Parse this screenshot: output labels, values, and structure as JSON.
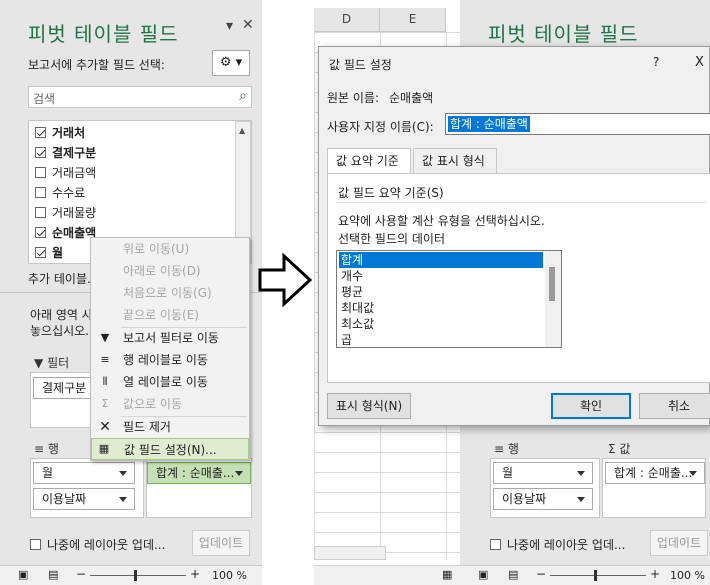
{
  "left_pane": {
    "title": "피벗 테이블 필드",
    "subtitle": "보고서에 추가할 필드 선택:",
    "search_placeholder": "검색",
    "fields": [
      {
        "label": "거래처",
        "checked": true
      },
      {
        "label": "결제구분",
        "checked": true
      },
      {
        "label": "거래금액",
        "checked": false
      },
      {
        "label": "수수료",
        "checked": false
      },
      {
        "label": "거래물량",
        "checked": false
      },
      {
        "label": "순매출액",
        "checked": true
      },
      {
        "label": "월",
        "checked": true
      }
    ],
    "more_tables_label": "추가 테이블...",
    "areas_hint_line1": "아래 영역 사",
    "areas_hint_line2": "놓으십시오.",
    "filter_header": "필터",
    "filter_item": "결제구분",
    "rows_header": "행",
    "rows_items": [
      "월",
      "이용날짜"
    ],
    "values_item": "합계 : 순매출...",
    "defer_label": "나중에 레이아웃 업데...",
    "update_button": "업데이트",
    "zoom": "100 %"
  },
  "context_menu": [
    {
      "label": "위로 이동(U)",
      "disabled": true,
      "icon": ""
    },
    {
      "label": "아래로 이동(D)",
      "disabled": true,
      "icon": ""
    },
    {
      "label": "처음으로 이동(G)",
      "disabled": true,
      "icon": ""
    },
    {
      "label": "끝으로 이동(E)",
      "disabled": true,
      "icon": ""
    },
    {
      "label": "보고서 필터로 이동",
      "disabled": false,
      "icon": "filter-icon"
    },
    {
      "label": "행 레이블로 이동",
      "disabled": false,
      "icon": "rows-icon"
    },
    {
      "label": "열 레이블로 이동",
      "disabled": false,
      "icon": "columns-icon"
    },
    {
      "label": "값으로 이동",
      "disabled": true,
      "icon": "sigma-icon"
    },
    {
      "label": "필드 제거",
      "disabled": false,
      "icon": "close-icon"
    },
    {
      "label": "값 필드 설정(N)...",
      "disabled": false,
      "icon": "field-settings-icon"
    }
  ],
  "right": {
    "col_d": "D",
    "col_e": "E",
    "pane_title": "피벗 테이블 필드",
    "rows_header": "행",
    "values_header": "값",
    "rows_item": "월",
    "rows_item2": "이용날짜",
    "values_item": "합계 : 순매출...",
    "defer_label": "나중에 레이아웃 업데...",
    "update_button": "업데이트",
    "zoom": "100 %"
  },
  "dialog": {
    "title": "값 필드 설정",
    "help": "?",
    "close": "X",
    "source_label": "원본 이름:",
    "source_value": "순매출액",
    "custom_label": "사용자 지정 이름(C):",
    "custom_value": "합계 : 순매출액",
    "tab_summarize": "값 요약 기준",
    "tab_show": "값 표시 형식",
    "group_label": "값 필드 요약 기준(S)",
    "instruction": "요약에 사용할 계산 유형을 선택하십시오.",
    "data_label": "선택한 필드의 데이터",
    "functions": [
      "합계",
      "개수",
      "평균",
      "최대값",
      "최소값",
      "곱"
    ],
    "number_format_button": "표시 형식(N)",
    "ok_button": "확인",
    "cancel_button": "취소"
  },
  "colors": {
    "excel_green": "#217346",
    "selection_blue": "#0078d7"
  }
}
